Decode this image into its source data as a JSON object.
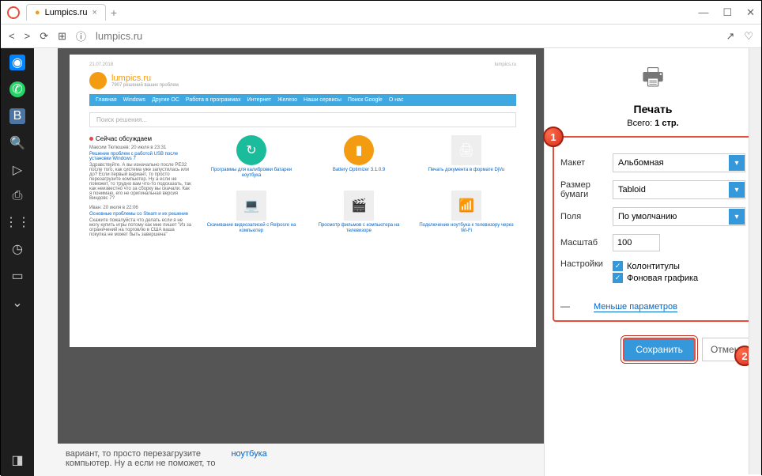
{
  "tab": {
    "title": "Lumpics.ru"
  },
  "url": "lumpics.ru",
  "win": {
    "min": "—",
    "max": "☐",
    "close": "✕"
  },
  "preview": {
    "date": "21.07.2018",
    "site": "lumpics.ru",
    "tagline": "7907 решений ваших проблем",
    "nav": [
      "Главная",
      "Windows",
      "Другие ОС",
      "Работа в программах",
      "Интернет",
      "Железо",
      "Наши сервисы",
      "Поиск Google",
      "О нас"
    ],
    "search_ph": "Поиск решения...",
    "discuss": "Сейчас обсуждаем",
    "post1_meta": "Максим Тютюшев: 20 июля в 23:31",
    "post1_link": "Решение проблем с работой USB после установки Windows 7",
    "post1_body": "Здравствуйте. А вы изначально после РЕЗ2 после того, как система уже запустилась или до? Если первый вариант, то просто перезагрузите компьютер. Ну а если не поможет, то трудно вам что-то подсказать, так как неизвестно что за сборку вы скачали. Как я понимаю, его не оригинальная версия Виндовс 7?",
    "post2_meta": "Иван: 20 июля в 22:06",
    "post2_link": "Основные проблемы со Steam и их решение",
    "post2_body": "Скажите пожалуйста что делать если я не могу купить игры потому как мне пишет \"Из за ограничений на торговлю в США ваша покупка не может быть завершена\"",
    "items": [
      "Программы для калибровки батареи ноутбука",
      "Battery Optimizer 3.1.0.9",
      "Печать документа в формате DjVu",
      "Скачивание видеозаписей с Relposre на компьютер",
      "Просмотр фильмов с компьютера на телевизоре",
      "Подключение ноутбука к телевизору через Wi-Fi"
    ]
  },
  "below": {
    "text1": "вариант, то просто перезагрузите",
    "text2": "компьютер. Ну а если не поможет, то",
    "link": "ноутбука"
  },
  "print": {
    "title": "Печать",
    "total_label": "Всего:",
    "total_pages": "1 стр.",
    "layout_label": "Макет",
    "layout_value": "Альбомная",
    "paper_label": "Размер бумаги",
    "paper_value": "Tabloid",
    "margins_label": "Поля",
    "margins_value": "По умолчанию",
    "scale_label": "Масштаб",
    "scale_value": "100",
    "settings_label": "Настройки",
    "opt_headers": "Колонтитулы",
    "opt_bg": "Фоновая графика",
    "less": "Меньше параметров",
    "save": "Сохранить",
    "cancel": "Отмена"
  },
  "badges": {
    "b1": "1",
    "b2": "2"
  }
}
